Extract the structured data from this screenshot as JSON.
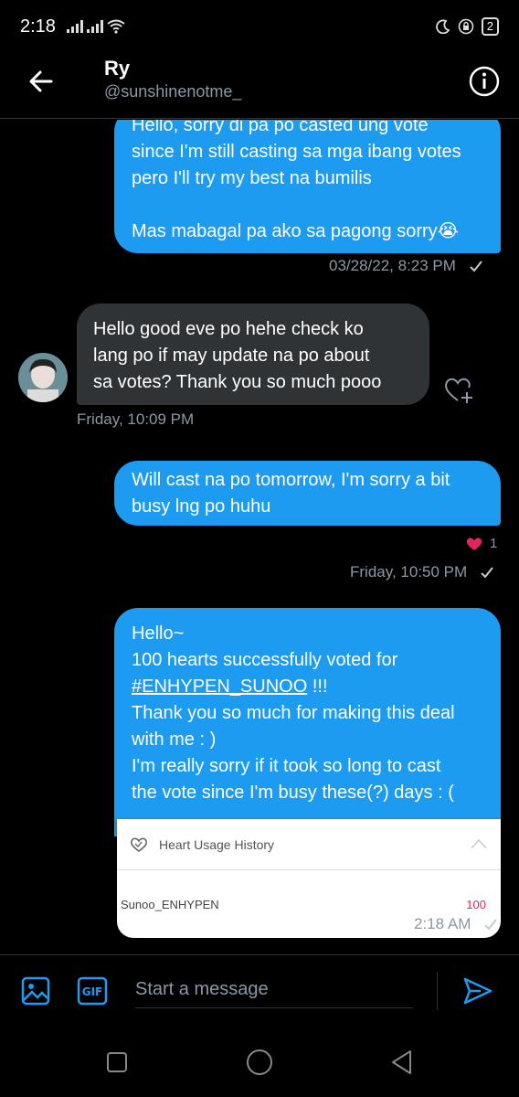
{
  "status_bar": {
    "time": "2:18",
    "battery": "2"
  },
  "header": {
    "name": "Ry",
    "handle": "@sunshinenotme_"
  },
  "messages": [
    {
      "direction": "out",
      "text": "Hello, sorry di pa po casted ung vote\nsince I'm still casting sa mga ibang votes\npero I'll try my best na bumilis\n\nMas mabagal pa ako sa pagong sorry😭",
      "meta": "03/28/22, 8:23 PM"
    },
    {
      "direction": "in",
      "text": "Hello good eve po hehe check ko\nlang po if may update na po about\nsa votes? Thank you so much pooo",
      "meta": "Friday, 10:09 PM"
    },
    {
      "direction": "out",
      "text": "Will cast na po tomorrow, I'm sorry a bit\nbusy lng po huhu",
      "meta": "Friday, 10:50 PM",
      "reaction_count": "1"
    },
    {
      "direction": "out",
      "line1": "Hello~",
      "line2": "100 hearts successfully voted for",
      "hashtag": "#ENHYPEN_SUNOO",
      "after_hashtag": " !!!",
      "rest": "Thank you so much for making this deal\nwith me : )\nI'm really sorry if it took so long to cast\nthe vote since I'm busy these(?) days : (",
      "meta": "2:18 AM"
    }
  ],
  "card": {
    "title": "Heart Usage History",
    "row_name": "Sunoo_ENHYPEN",
    "row_value": "100"
  },
  "composer": {
    "placeholder": "Start a message"
  },
  "icons": {
    "back": "arrow-left-icon",
    "info": "info-icon",
    "image": "image-icon",
    "gif": "gif-icon",
    "send": "send-icon",
    "add_reaction": "heart-plus-icon",
    "reaction": "heart-icon",
    "check": "check-icon"
  },
  "colors": {
    "accent": "#1d9bf0",
    "bubble_in": "#2f3336",
    "heart": "#e0245e",
    "muted": "#8b98a5"
  }
}
